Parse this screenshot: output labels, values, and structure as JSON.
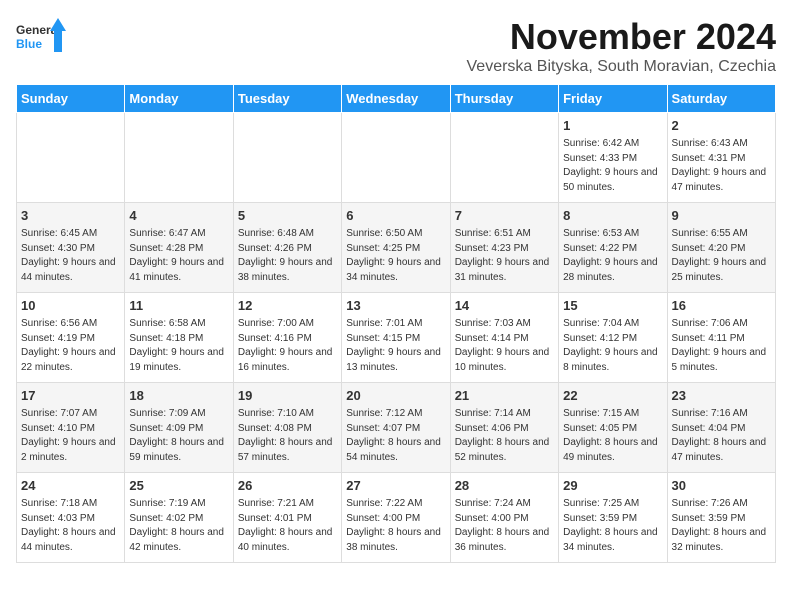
{
  "logo": {
    "text_general": "General",
    "text_blue": "Blue"
  },
  "header": {
    "month": "November 2024",
    "location": "Veverska Bityska, South Moravian, Czechia"
  },
  "weekdays": [
    "Sunday",
    "Monday",
    "Tuesday",
    "Wednesday",
    "Thursday",
    "Friday",
    "Saturday"
  ],
  "weeks": [
    {
      "days": [
        {
          "num": "",
          "info": ""
        },
        {
          "num": "",
          "info": ""
        },
        {
          "num": "",
          "info": ""
        },
        {
          "num": "",
          "info": ""
        },
        {
          "num": "",
          "info": ""
        },
        {
          "num": "1",
          "info": "Sunrise: 6:42 AM\nSunset: 4:33 PM\nDaylight: 9 hours and 50 minutes."
        },
        {
          "num": "2",
          "info": "Sunrise: 6:43 AM\nSunset: 4:31 PM\nDaylight: 9 hours and 47 minutes."
        }
      ]
    },
    {
      "days": [
        {
          "num": "3",
          "info": "Sunrise: 6:45 AM\nSunset: 4:30 PM\nDaylight: 9 hours and 44 minutes."
        },
        {
          "num": "4",
          "info": "Sunrise: 6:47 AM\nSunset: 4:28 PM\nDaylight: 9 hours and 41 minutes."
        },
        {
          "num": "5",
          "info": "Sunrise: 6:48 AM\nSunset: 4:26 PM\nDaylight: 9 hours and 38 minutes."
        },
        {
          "num": "6",
          "info": "Sunrise: 6:50 AM\nSunset: 4:25 PM\nDaylight: 9 hours and 34 minutes."
        },
        {
          "num": "7",
          "info": "Sunrise: 6:51 AM\nSunset: 4:23 PM\nDaylight: 9 hours and 31 minutes."
        },
        {
          "num": "8",
          "info": "Sunrise: 6:53 AM\nSunset: 4:22 PM\nDaylight: 9 hours and 28 minutes."
        },
        {
          "num": "9",
          "info": "Sunrise: 6:55 AM\nSunset: 4:20 PM\nDaylight: 9 hours and 25 minutes."
        }
      ]
    },
    {
      "days": [
        {
          "num": "10",
          "info": "Sunrise: 6:56 AM\nSunset: 4:19 PM\nDaylight: 9 hours and 22 minutes."
        },
        {
          "num": "11",
          "info": "Sunrise: 6:58 AM\nSunset: 4:18 PM\nDaylight: 9 hours and 19 minutes."
        },
        {
          "num": "12",
          "info": "Sunrise: 7:00 AM\nSunset: 4:16 PM\nDaylight: 9 hours and 16 minutes."
        },
        {
          "num": "13",
          "info": "Sunrise: 7:01 AM\nSunset: 4:15 PM\nDaylight: 9 hours and 13 minutes."
        },
        {
          "num": "14",
          "info": "Sunrise: 7:03 AM\nSunset: 4:14 PM\nDaylight: 9 hours and 10 minutes."
        },
        {
          "num": "15",
          "info": "Sunrise: 7:04 AM\nSunset: 4:12 PM\nDaylight: 9 hours and 8 minutes."
        },
        {
          "num": "16",
          "info": "Sunrise: 7:06 AM\nSunset: 4:11 PM\nDaylight: 9 hours and 5 minutes."
        }
      ]
    },
    {
      "days": [
        {
          "num": "17",
          "info": "Sunrise: 7:07 AM\nSunset: 4:10 PM\nDaylight: 9 hours and 2 minutes."
        },
        {
          "num": "18",
          "info": "Sunrise: 7:09 AM\nSunset: 4:09 PM\nDaylight: 8 hours and 59 minutes."
        },
        {
          "num": "19",
          "info": "Sunrise: 7:10 AM\nSunset: 4:08 PM\nDaylight: 8 hours and 57 minutes."
        },
        {
          "num": "20",
          "info": "Sunrise: 7:12 AM\nSunset: 4:07 PM\nDaylight: 8 hours and 54 minutes."
        },
        {
          "num": "21",
          "info": "Sunrise: 7:14 AM\nSunset: 4:06 PM\nDaylight: 8 hours and 52 minutes."
        },
        {
          "num": "22",
          "info": "Sunrise: 7:15 AM\nSunset: 4:05 PM\nDaylight: 8 hours and 49 minutes."
        },
        {
          "num": "23",
          "info": "Sunrise: 7:16 AM\nSunset: 4:04 PM\nDaylight: 8 hours and 47 minutes."
        }
      ]
    },
    {
      "days": [
        {
          "num": "24",
          "info": "Sunrise: 7:18 AM\nSunset: 4:03 PM\nDaylight: 8 hours and 44 minutes."
        },
        {
          "num": "25",
          "info": "Sunrise: 7:19 AM\nSunset: 4:02 PM\nDaylight: 8 hours and 42 minutes."
        },
        {
          "num": "26",
          "info": "Sunrise: 7:21 AM\nSunset: 4:01 PM\nDaylight: 8 hours and 40 minutes."
        },
        {
          "num": "27",
          "info": "Sunrise: 7:22 AM\nSunset: 4:00 PM\nDaylight: 8 hours and 38 minutes."
        },
        {
          "num": "28",
          "info": "Sunrise: 7:24 AM\nSunset: 4:00 PM\nDaylight: 8 hours and 36 minutes."
        },
        {
          "num": "29",
          "info": "Sunrise: 7:25 AM\nSunset: 3:59 PM\nDaylight: 8 hours and 34 minutes."
        },
        {
          "num": "30",
          "info": "Sunrise: 7:26 AM\nSunset: 3:59 PM\nDaylight: 8 hours and 32 minutes."
        }
      ]
    }
  ]
}
